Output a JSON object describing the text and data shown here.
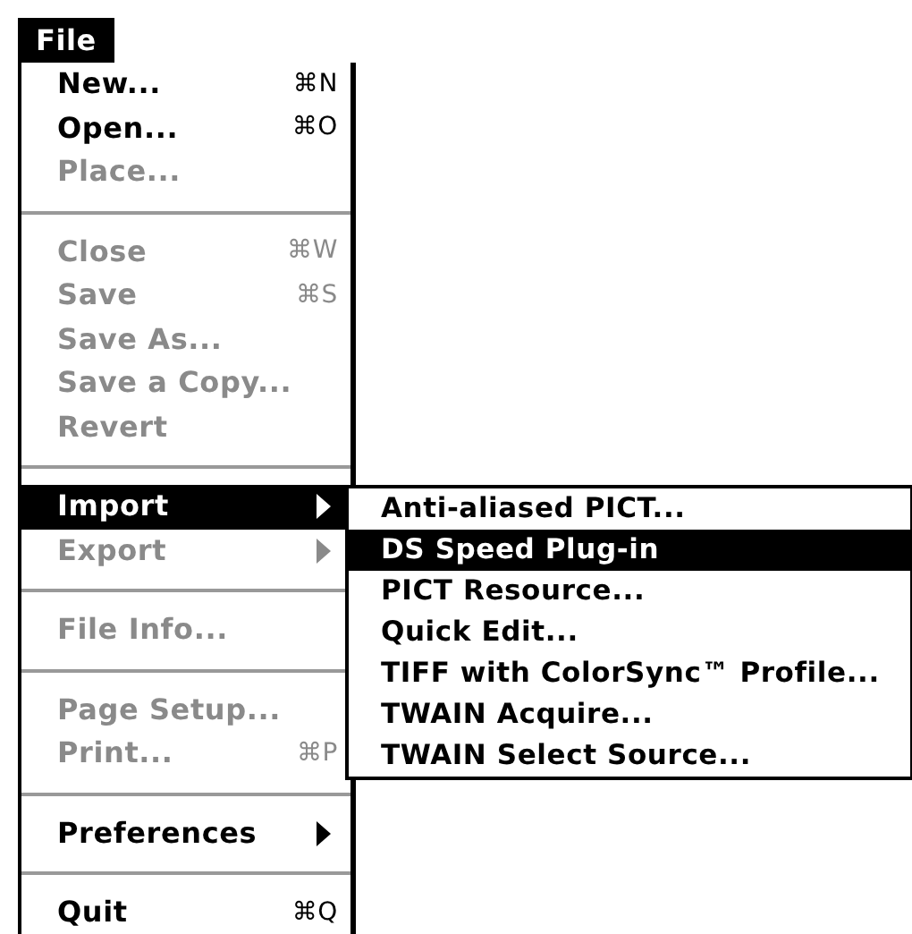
{
  "menu_title": "File",
  "groups": [
    [
      {
        "label": "New...",
        "shortcut": "⌘N",
        "disabled": false,
        "selected": false,
        "submenu": false
      },
      {
        "label": "Open...",
        "shortcut": "⌘O",
        "disabled": false,
        "selected": false,
        "submenu": false
      },
      {
        "label": "Place...",
        "disabled": true,
        "selected": false,
        "submenu": false
      }
    ],
    [
      {
        "label": "Close",
        "shortcut": "⌘W",
        "disabled": true,
        "selected": false,
        "submenu": false
      },
      {
        "label": "Save",
        "shortcut": "⌘S",
        "disabled": true,
        "selected": false,
        "submenu": false
      },
      {
        "label": "Save As...",
        "disabled": true,
        "selected": false,
        "submenu": false
      },
      {
        "label": "Save a Copy...",
        "disabled": true,
        "selected": false,
        "submenu": false
      },
      {
        "label": "Revert",
        "disabled": true,
        "selected": false,
        "submenu": false
      }
    ],
    [
      {
        "label": "Import",
        "disabled": false,
        "selected": true,
        "submenu": true
      },
      {
        "label": "Export",
        "disabled": true,
        "selected": false,
        "submenu": true
      }
    ],
    [
      {
        "label": "File Info...",
        "disabled": true,
        "selected": false,
        "submenu": false
      }
    ],
    [
      {
        "label": "Page Setup...",
        "disabled": true,
        "selected": false,
        "submenu": false
      },
      {
        "label": "Print...",
        "shortcut": "⌘P",
        "disabled": true,
        "selected": false,
        "submenu": false
      }
    ],
    [
      {
        "label": "Preferences",
        "disabled": false,
        "selected": false,
        "submenu": true
      }
    ],
    [
      {
        "label": "Quit",
        "shortcut": "⌘Q",
        "disabled": false,
        "selected": false,
        "submenu": false
      }
    ]
  ],
  "submenu_items": [
    {
      "label": "Anti-aliased PICT...",
      "selected": false
    },
    {
      "label": "DS Speed Plug-in",
      "selected": true
    },
    {
      "label": "PICT Resource...",
      "selected": false
    },
    {
      "label": "Quick Edit...",
      "selected": false
    },
    {
      "label": "TIFF with ColorSync™ Profile...",
      "selected": false
    },
    {
      "label": "TWAIN Acquire...",
      "selected": false
    },
    {
      "label": "TWAIN Select Source...",
      "selected": false
    }
  ]
}
